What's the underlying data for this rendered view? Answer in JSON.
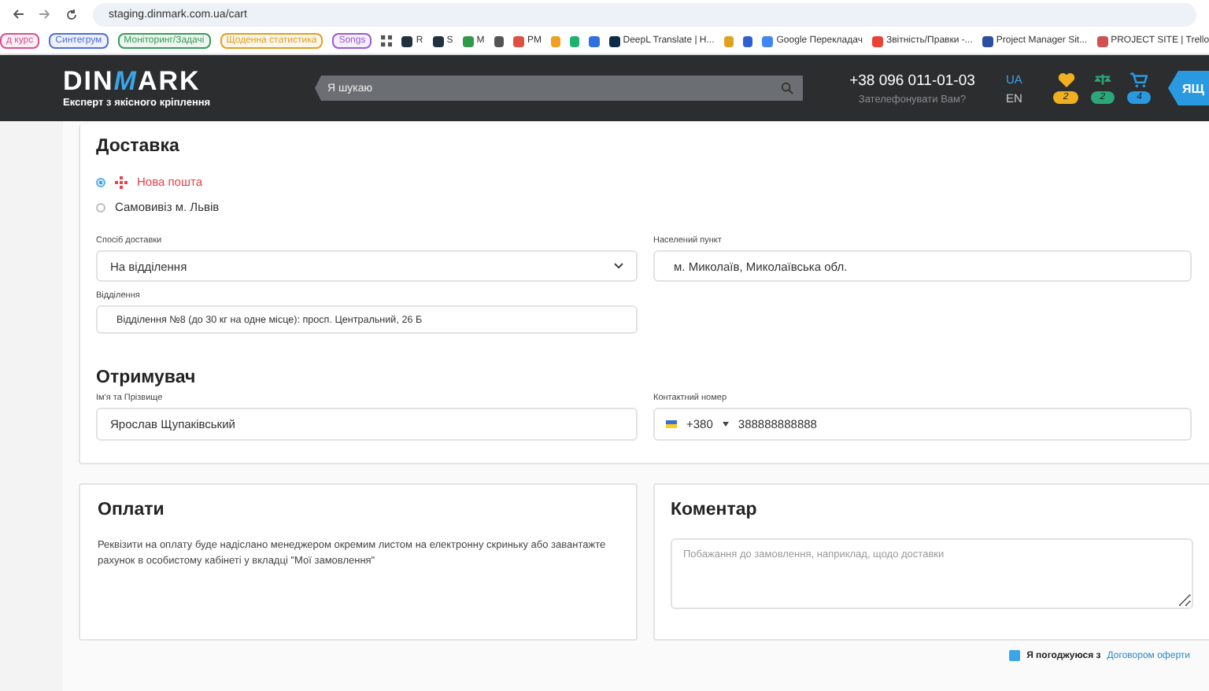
{
  "browser": {
    "url": "staging.dinmark.com.ua/cart",
    "bookmarks": [
      {
        "kind": "chip",
        "label": "д курс",
        "color": "#d94f8f"
      },
      {
        "kind": "chip",
        "label": "Синтегрум",
        "color": "#4f6fd9"
      },
      {
        "kind": "chip",
        "label": "Моніторинг/Задачі",
        "color": "#3a9a5a"
      },
      {
        "kind": "chip",
        "label": "Щоденна статистика",
        "color": "#e0a020"
      },
      {
        "kind": "chip",
        "label": "Songs",
        "color": "#9a5ad0"
      },
      {
        "kind": "apps"
      },
      {
        "kind": "link",
        "label": "R",
        "color": "#22313f"
      },
      {
        "kind": "link",
        "label": "S",
        "color": "#22313f"
      },
      {
        "kind": "link",
        "label": "M",
        "color": "#2e9a4a"
      },
      {
        "kind": "link",
        "color": "#555555"
      },
      {
        "kind": "link",
        "label": "PM",
        "color": "#e05040"
      },
      {
        "kind": "link",
        "color": "#f0a020"
      },
      {
        "kind": "link",
        "color": "#20b070"
      },
      {
        "kind": "link",
        "color": "#3070e0"
      },
      {
        "kind": "link",
        "label": "DeepL Translate | H...",
        "color": "#0f2b46"
      },
      {
        "kind": "link",
        "color": "#e0a020"
      },
      {
        "kind": "link",
        "color": "#3060d0"
      },
      {
        "kind": "link",
        "label": "Google Перекладач",
        "color": "#4285f4"
      },
      {
        "kind": "link",
        "label": "Звітність/Правки -...",
        "color": "#ea4335"
      },
      {
        "kind": "link",
        "label": "Project Manager Sit...",
        "color": "#2a4fa0"
      },
      {
        "kind": "link",
        "label": "PROJECT SITE | Trello",
        "color": "#d05050"
      }
    ]
  },
  "header": {
    "logo": {
      "start": "DIN",
      "accent": "M",
      "end": "ARK"
    },
    "tagline": "Експерт з якісного кріплення",
    "search": {
      "placeholder": "Я шукаю"
    },
    "phone": "+38 096 011-01-03",
    "callback": "Зателефонувати Вам?",
    "languages": [
      {
        "label": "UA",
        "selected": true
      },
      {
        "label": "EN",
        "selected": false
      }
    ],
    "counters": [
      {
        "kind": "heart",
        "count": "2",
        "color": "#f0b020"
      },
      {
        "kind": "scales",
        "count": "2",
        "color": "#2aa87a"
      },
      {
        "kind": "cart",
        "count": "4",
        "color": "#2a9ae0"
      }
    ],
    "account": "ЯЩ"
  },
  "delivery": {
    "title": "Доставка",
    "carriers": [
      {
        "label": "Нова пошта",
        "selected": true,
        "logo": true
      },
      {
        "label": "Самовивіз м. Львів",
        "selected": false,
        "logo": false
      }
    ],
    "method": {
      "label": "Спосіб доставки",
      "value": "На відділення"
    },
    "city": {
      "label": "Населений пункт",
      "value": "м. Миколаїв, Миколаївська обл."
    },
    "branch": {
      "label": "Відділення",
      "value": "Відділення №8 (до 30 кг на одне місце): просп. Центральний, 26 Б"
    }
  },
  "recipient": {
    "title": "Отримувач",
    "name": {
      "label": "Ім'я та Прізвище",
      "value": "Ярослав Щупаківський"
    },
    "phone": {
      "label": "Контактний номер",
      "code": "+380",
      "value": "388888888888"
    }
  },
  "payment": {
    "title": "Оплати",
    "text": "Реквізити на оплату буде надіслано менеджером окремим листом на електронну скриньку або завантажте рахунок в особистому кабінеті у вкладці \"Мої замовлення\""
  },
  "comment": {
    "title": "Коментар",
    "placeholder": "Побажання до замовлення, наприклад, щодо доставки"
  },
  "agreement": {
    "checked": true,
    "text": "Я погоджуюся з",
    "link": "Договором оферти"
  }
}
